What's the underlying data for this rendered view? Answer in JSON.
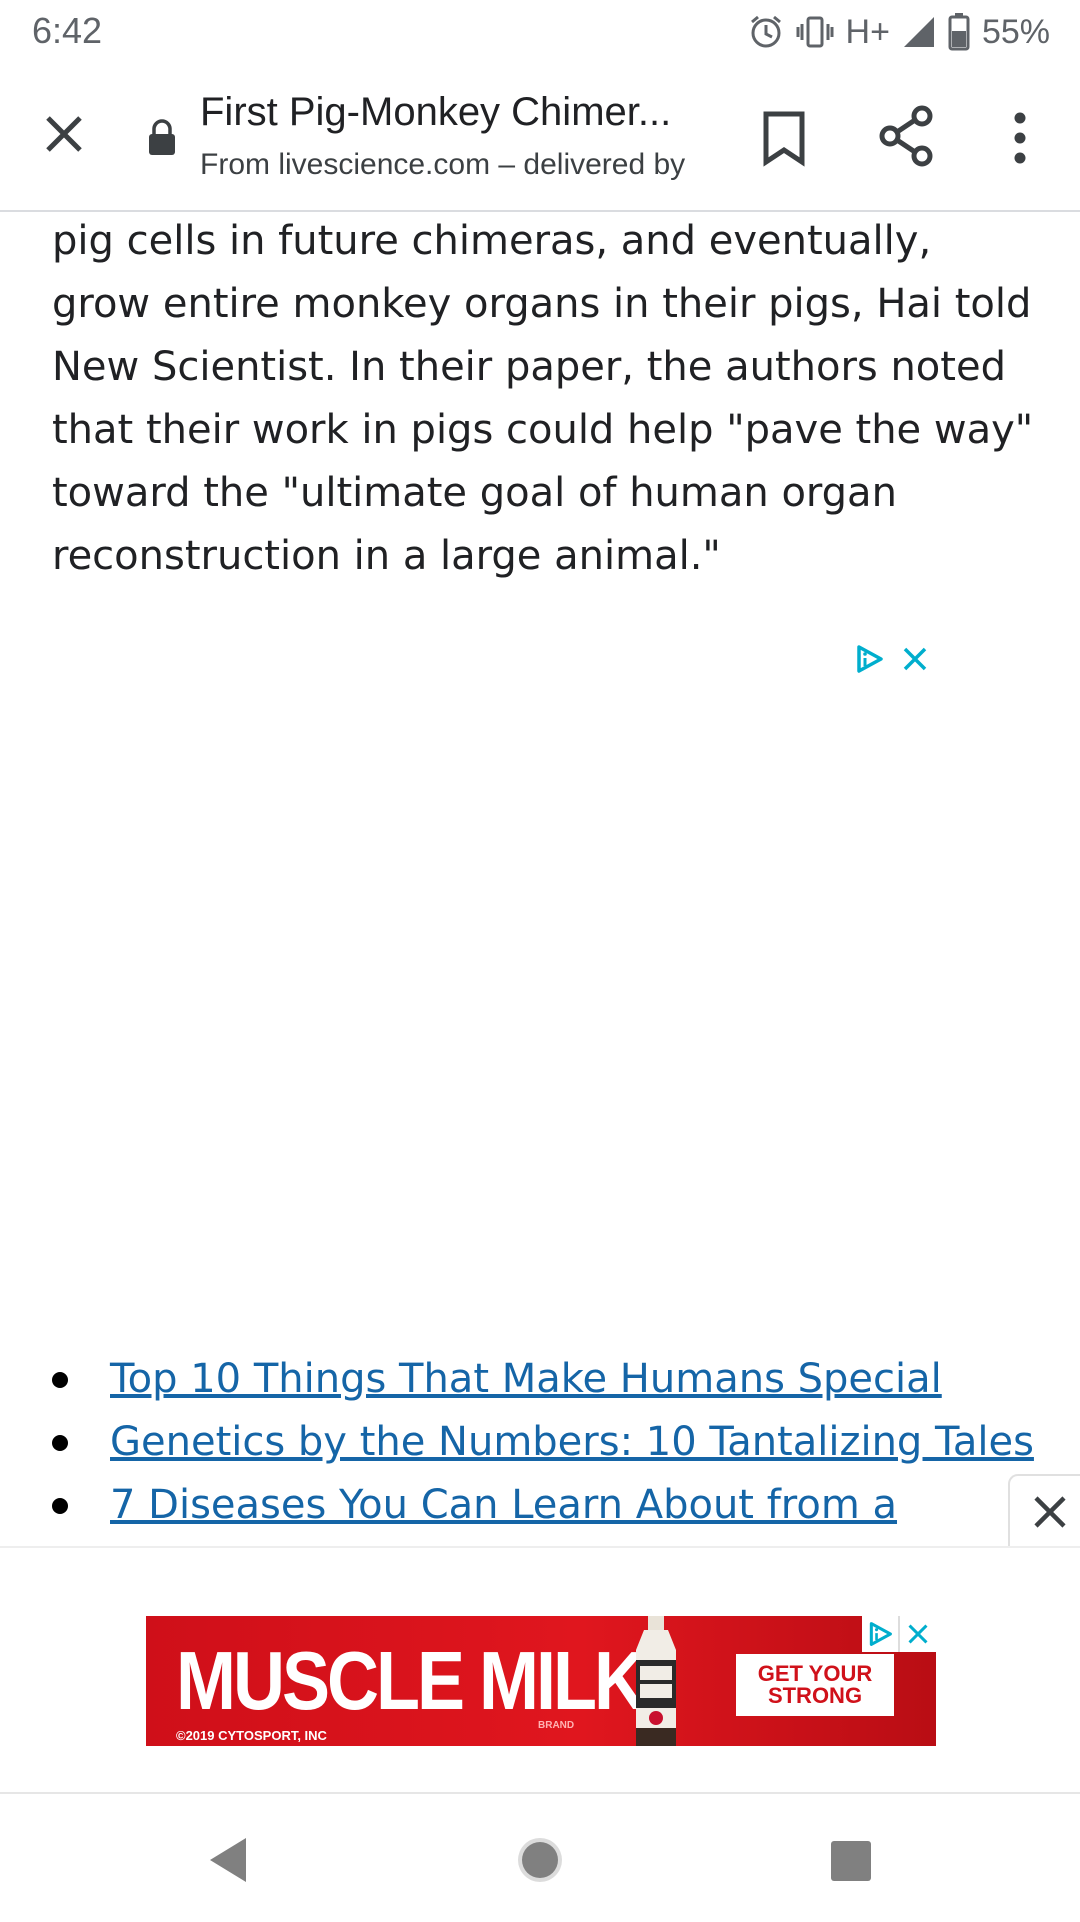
{
  "status_bar": {
    "time": "6:42",
    "network": "H+",
    "battery": "55%"
  },
  "toolbar": {
    "title": "First Pig-Monkey Chimer...",
    "subtitle": "From livescience.com – delivered by"
  },
  "article": {
    "paragraph": "pig cells in future chimeras, and eventually, grow entire monkey organs in their pigs, Hai told New Scientist. In their paper, the authors noted that their work in pigs could help \"pave the way\" toward the \"ultimate goal of human organ reconstruction in a large animal.\""
  },
  "related_links": [
    "Top 10 Things That Make Humans Special",
    "Genetics by the Numbers: 10 Tantalizing Tales",
    "7 Diseases You Can Learn About from a"
  ],
  "bottom_ad": {
    "brand": "MUSCLE MILK",
    "copyright": "©2019 CYTOSPORT, INC",
    "brand_tag": "BRAND",
    "cta": "GET YOUR STRONG"
  },
  "colors": {
    "link": "#1565a7",
    "adchoices": "#00aecd",
    "banner_red": "#d0111a"
  }
}
